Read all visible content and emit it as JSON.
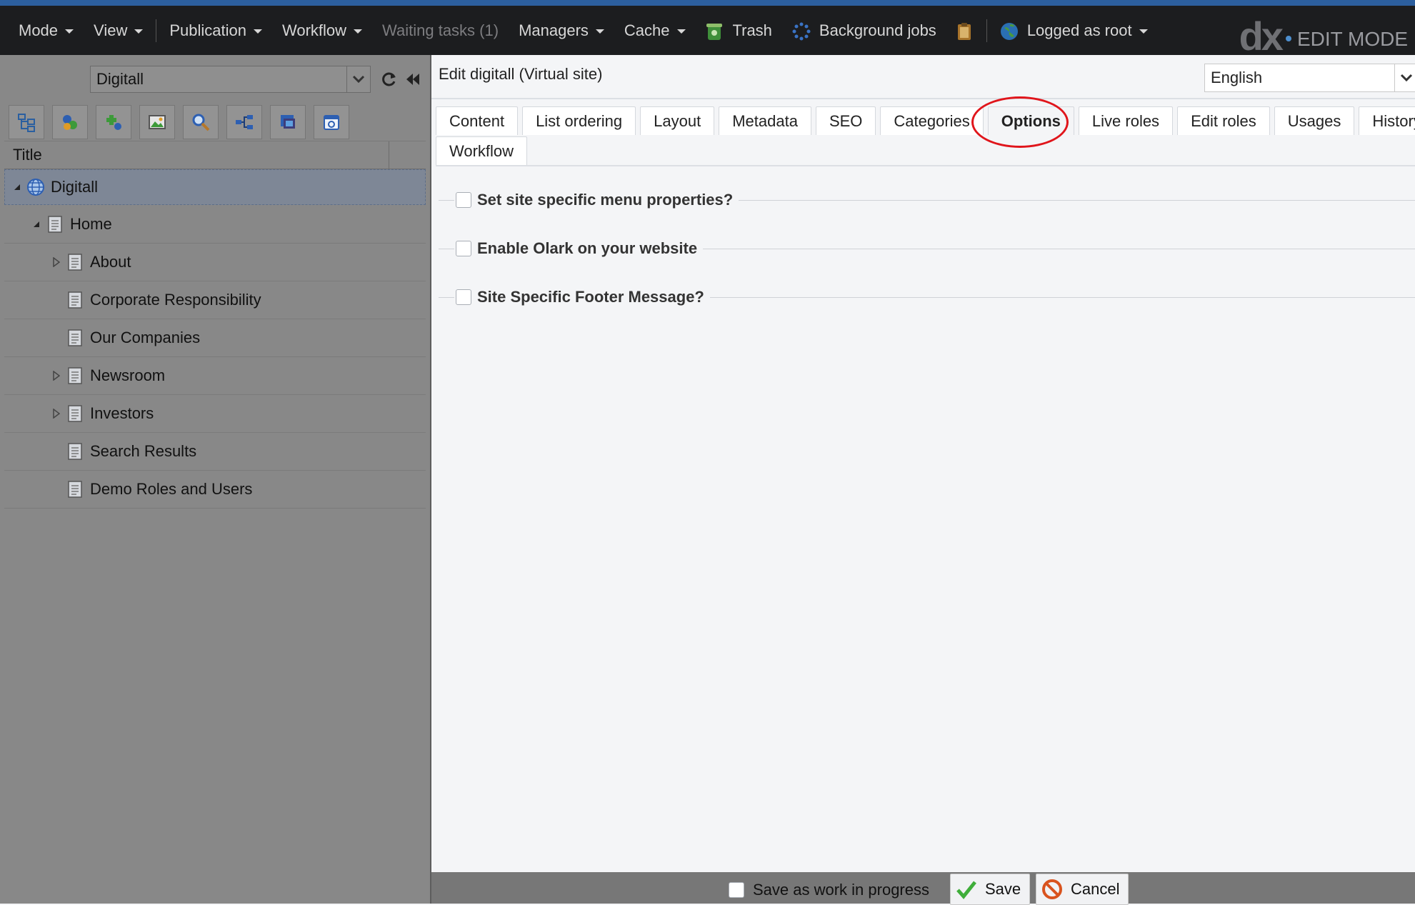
{
  "topbar": {
    "menus": [
      {
        "label": "Mode",
        "has_caret": true
      },
      {
        "label": "View",
        "has_caret": true
      },
      {
        "label": "Publication",
        "has_caret": true
      },
      {
        "label": "Workflow",
        "has_caret": true
      },
      {
        "label": "Waiting tasks (1)",
        "has_caret": false,
        "disabled": true
      },
      {
        "label": "Managers",
        "has_caret": true
      },
      {
        "label": "Cache",
        "has_caret": true
      }
    ],
    "trash_label": "Trash",
    "background_jobs_label": "Background jobs",
    "user_label": "Logged as root",
    "logo_text": "dx",
    "mode_label": "EDIT MODE"
  },
  "left_panel": {
    "site_selector": {
      "value": "Digitall"
    },
    "toolbar_icons": [
      "sitemap-icon",
      "content-icon",
      "components-icon",
      "images-icon",
      "search-icon",
      "categories-icon",
      "portlets-icon",
      "calendar-icon"
    ],
    "tree_header": "Title",
    "tree": [
      {
        "label": "Digitall",
        "level": 0,
        "expander": "expanded",
        "icon": "globe-icon",
        "selected": true
      },
      {
        "label": "Home",
        "level": 1,
        "expander": "expanded",
        "icon": "page-icon"
      },
      {
        "label": "About",
        "level": 2,
        "expander": "collapsed",
        "icon": "page-icon"
      },
      {
        "label": "Corporate Responsibility",
        "level": 2,
        "expander": "none",
        "icon": "page-icon"
      },
      {
        "label": "Our Companies",
        "level": 2,
        "expander": "none",
        "icon": "page-icon"
      },
      {
        "label": "Newsroom",
        "level": 2,
        "expander": "collapsed",
        "icon": "page-icon"
      },
      {
        "label": "Investors",
        "level": 2,
        "expander": "collapsed",
        "icon": "page-icon"
      },
      {
        "label": "Search Results",
        "level": 2,
        "expander": "none",
        "icon": "page-icon"
      },
      {
        "label": "Demo Roles and Users",
        "level": 2,
        "expander": "none",
        "icon": "page-icon"
      }
    ]
  },
  "editor": {
    "title": "Edit digitall (Virtual site)",
    "language": "English",
    "tabs_row1": [
      "Content",
      "List ordering",
      "Layout",
      "Metadata",
      "SEO",
      "Categories",
      "Options",
      "Live roles",
      "Edit roles",
      "Usages",
      "History"
    ],
    "tabs_row2": [
      "Workflow"
    ],
    "active_tab": "Options",
    "options": [
      {
        "label": "Set site specific menu properties?",
        "checked": false
      },
      {
        "label": "Enable Olark on your website",
        "checked": false
      },
      {
        "label": "Site Specific Footer Message?",
        "checked": false
      }
    ]
  },
  "footer": {
    "work_in_progress_label": "Save as work in progress",
    "work_in_progress_checked": false,
    "save_label": "Save",
    "cancel_label": "Cancel"
  },
  "colors": {
    "topbar_bg": "#1c1d1f",
    "accent_stripe": "#2c5f9e",
    "left_panel_bg": "#888888",
    "highlight": "#e0151b"
  }
}
